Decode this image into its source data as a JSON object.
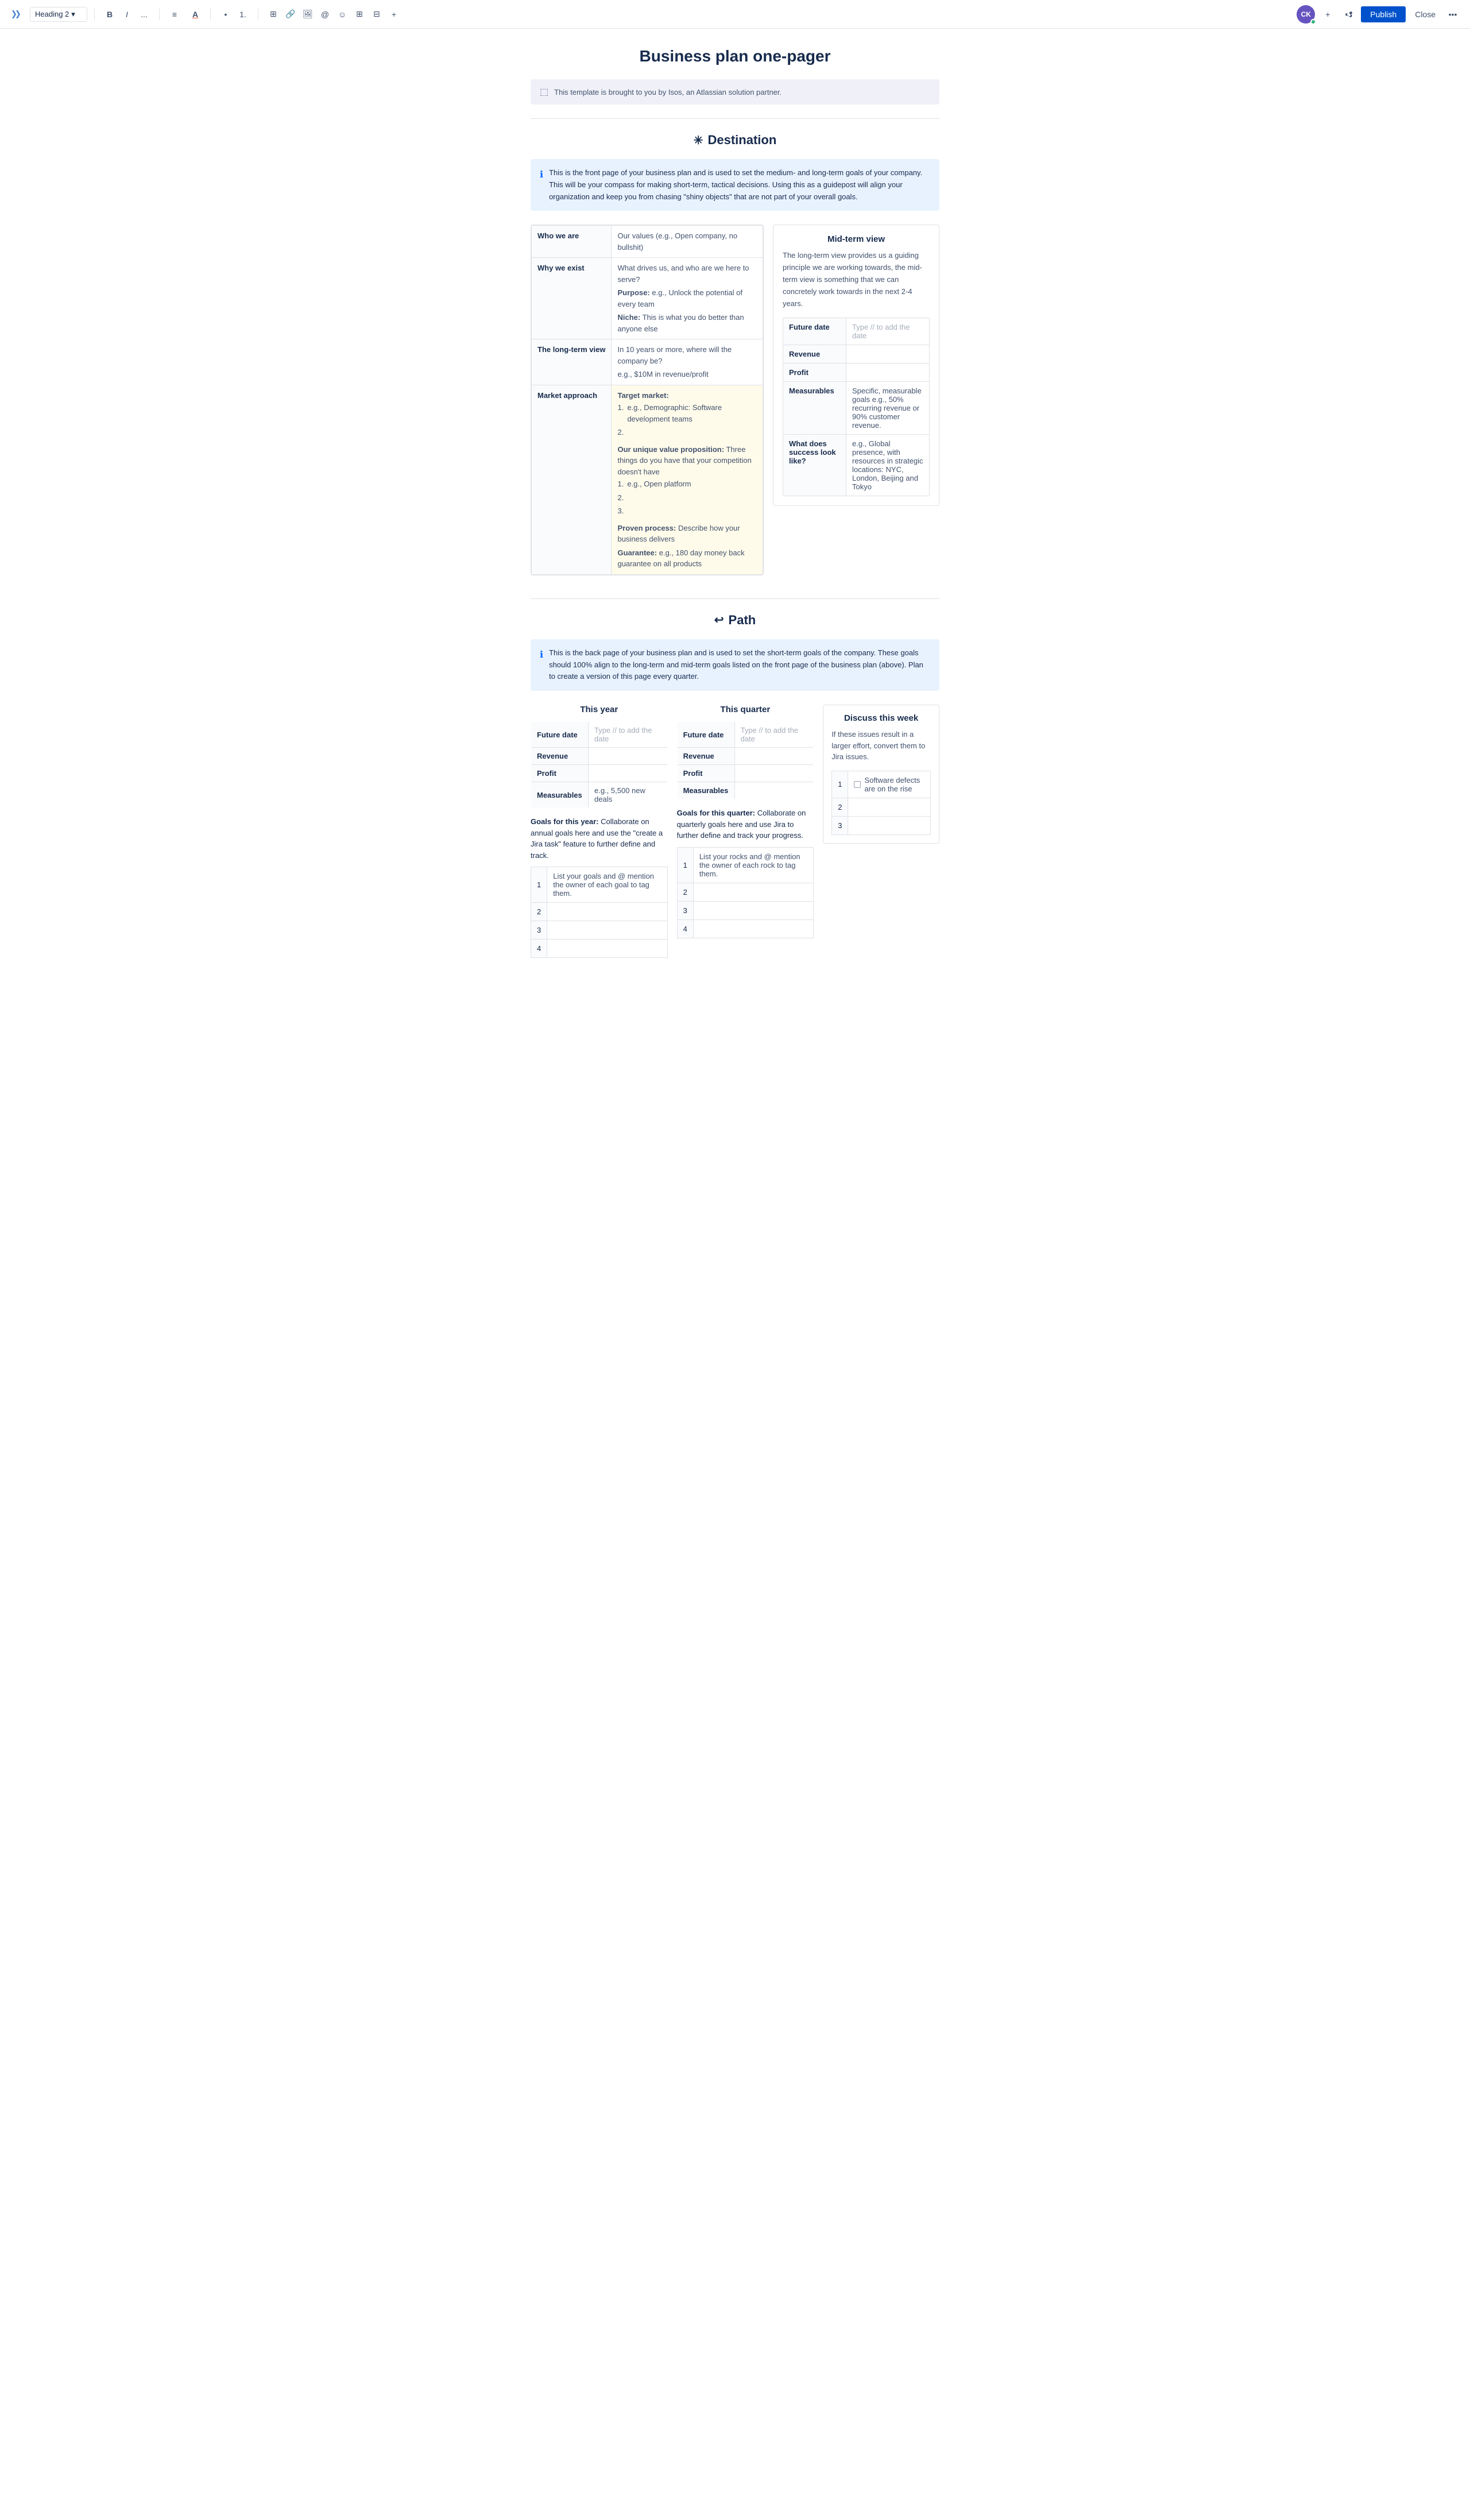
{
  "toolbar": {
    "logo_label": "Confluence",
    "heading_select": "Heading 2",
    "bold": "B",
    "italic": "I",
    "more": "...",
    "align": "≡",
    "text_color": "A",
    "bullet_list": "•",
    "numbered_list": "1.",
    "media": "▦",
    "link": "🔗",
    "image": "🖼",
    "mention": "@",
    "emoji": "☺",
    "table": "⊞",
    "columns": "⊟",
    "more_insert": "+",
    "avatar_initials": "CK",
    "publish_label": "Publish",
    "close_label": "Close"
  },
  "page": {
    "title": "Business plan one-pager",
    "template_notice": "This template is brought to you by Isos, an Atlassian solution partner."
  },
  "destination": {
    "heading": "Destination",
    "heading_icon": "✳",
    "callout": "This is the front page of your business plan and is used to set the medium- and long-term goals of your company. This will be your compass for making short-term, tactical decisions. Using this as a guidepost will align your organization and keep you from chasing \"shiny objects\" that are not part of your overall goals.",
    "table": {
      "rows": [
        {
          "label": "Who we are",
          "content": "Our values (e.g., Open company, no bullshit)"
        },
        {
          "label": "Why we exist",
          "content_parts": [
            "What drives us, and who are we here to serve?",
            "Purpose: e.g., Unlock the potential of every team",
            "Niche: This is what you do better than anyone else"
          ]
        },
        {
          "label": "The long-term view",
          "content_parts": [
            "In 10 years or more, where will the company be?",
            "e.g., $10M in revenue/profit"
          ]
        },
        {
          "label": "Market approach",
          "target_market": "Target market:",
          "market_items": [
            "e.g., Demographic: Software development teams",
            "",
            ""
          ],
          "proposition_label": "Our unique value proposition:",
          "proposition_text": " Three things do you have that your competition doesn't have",
          "proposition_items": [
            "e.g., Open platform",
            "",
            ""
          ],
          "process_label": "Proven process:",
          "process_text": " Describe how your business delivers",
          "guarantee_label": "Guarantee:",
          "guarantee_text": " e.g., 180 day money back guarantee on all products"
        }
      ]
    },
    "mid_term": {
      "title": "Mid-term view",
      "description": "The long-term view provides us a guiding principle we are working towards, the mid-term view is something that we can concretely work towards in the next 2-4 years.",
      "table_rows": [
        {
          "label": "Future date",
          "value": "Type // to add the date"
        },
        {
          "label": "Revenue",
          "value": ""
        },
        {
          "label": "Profit",
          "value": ""
        },
        {
          "label": "Measurables",
          "value": "Specific, measurable goals e.g., 50% recurring revenue or 90% customer revenue."
        },
        {
          "label": "What does success look like?",
          "value": "e.g., Global presence, with resources in strategic locations: NYC, London, Beijing and Tokyo"
        }
      ]
    }
  },
  "path": {
    "heading": "Path",
    "heading_icon": "↩",
    "callout": "This is the back page of your business plan and is used to set the short-term goals of the company. These goals should 100% align to the long-term and mid-term goals listed on the front page of the business plan (above). Plan to create a version of this page every quarter.",
    "this_year": {
      "title": "This year",
      "table_rows": [
        {
          "label": "Future date",
          "value": "Type // to add the date"
        },
        {
          "label": "Revenue",
          "value": ""
        },
        {
          "label": "Profit",
          "value": ""
        },
        {
          "label": "Measurables",
          "value": "e.g., 5,500 new deals"
        }
      ],
      "goals_text_bold": "Goals for this year:",
      "goals_text": " Collaborate on annual goals here and use the \"create a Jira task\" feature to further define and track.",
      "goals_rows": [
        "List your goals and @ mention the owner of each goal to tag them.",
        "",
        "",
        ""
      ]
    },
    "this_quarter": {
      "title": "This quarter",
      "table_rows": [
        {
          "label": "Future date",
          "value": "Type // to add the date"
        },
        {
          "label": "Revenue",
          "value": ""
        },
        {
          "label": "Profit",
          "value": ""
        },
        {
          "label": "Measurables",
          "value": ""
        }
      ],
      "goals_text_bold": "Goals for this quarter:",
      "goals_text": " Collaborate on quarterly goals here and use Jira to further define and track your progress.",
      "goals_rows": [
        "List your rocks and @ mention the owner of each rock to tag them.",
        "",
        "",
        ""
      ]
    },
    "discuss": {
      "title": "Discuss this week",
      "description": "If these issues result in a larger effort, convert them to Jira issues.",
      "rows": [
        {
          "num": "1",
          "content": "Software defects are on the rise",
          "has_checkbox": true
        },
        {
          "num": "2",
          "content": ""
        },
        {
          "num": "3",
          "content": ""
        }
      ]
    }
  }
}
